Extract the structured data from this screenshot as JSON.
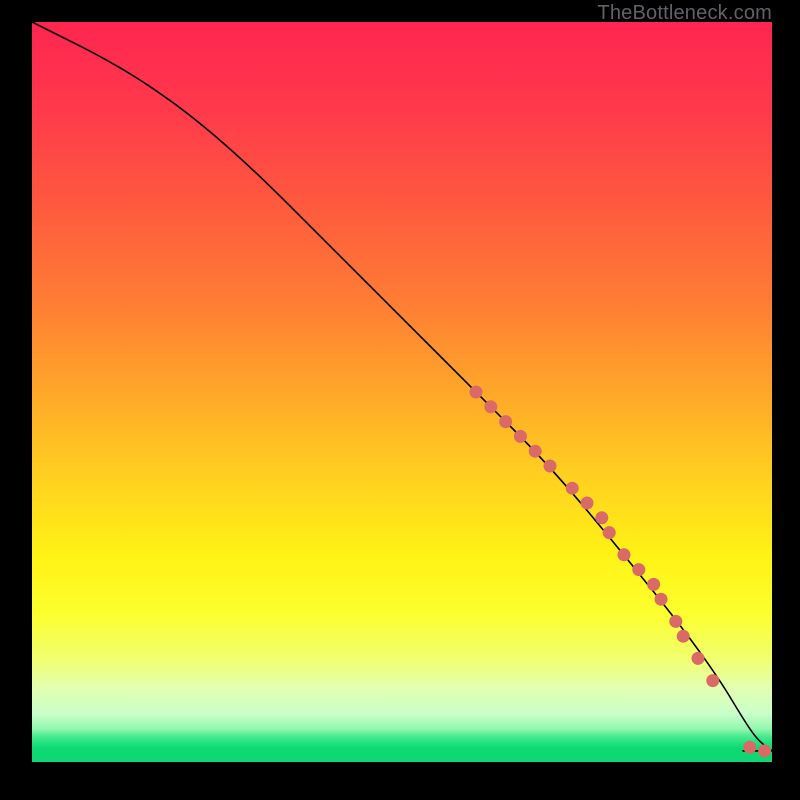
{
  "watermark": "TheBottleneck.com",
  "colors": {
    "dot": "#d96a65",
    "line": "#000000",
    "gradient_stops": [
      {
        "offset": 0.0,
        "color": "#ff2550"
      },
      {
        "offset": 0.12,
        "color": "#ff3a4b"
      },
      {
        "offset": 0.25,
        "color": "#ff5a3e"
      },
      {
        "offset": 0.38,
        "color": "#ff7d34"
      },
      {
        "offset": 0.5,
        "color": "#ffa729"
      },
      {
        "offset": 0.62,
        "color": "#ffd21f"
      },
      {
        "offset": 0.72,
        "color": "#fff215"
      },
      {
        "offset": 0.8,
        "color": "#fcff2e"
      },
      {
        "offset": 0.86,
        "color": "#f0ff6e"
      },
      {
        "offset": 0.9,
        "color": "#e3ffb0"
      },
      {
        "offset": 0.935,
        "color": "#c9ffc9"
      },
      {
        "offset": 0.955,
        "color": "#93f7af"
      },
      {
        "offset": 0.965,
        "color": "#4beb8f"
      },
      {
        "offset": 0.975,
        "color": "#1fe07c"
      },
      {
        "offset": 0.982,
        "color": "#0fd873"
      },
      {
        "offset": 1.0,
        "color": "#0fd873"
      }
    ]
  },
  "chart_data": {
    "type": "line",
    "title": "",
    "xlabel": "",
    "ylabel": "",
    "xlim": [
      0,
      100
    ],
    "ylim": [
      0,
      100
    ],
    "series": [
      {
        "name": "curve",
        "x": [
          0,
          4,
          9,
          15,
          22,
          30,
          40,
          50,
          60,
          70,
          80,
          88,
          93,
          96,
          98,
          100
        ],
        "y": [
          100,
          98,
          95.5,
          92,
          87,
          80,
          70,
          60,
          50,
          40,
          28,
          18,
          11,
          6,
          3,
          1.5
        ]
      },
      {
        "name": "flat-tail",
        "x": [
          96,
          100
        ],
        "y": [
          1.5,
          1.5
        ]
      }
    ],
    "scatter": {
      "name": "points",
      "x": [
        60,
        62,
        64,
        66,
        68,
        70,
        73,
        75,
        77,
        78,
        80,
        82,
        84,
        85,
        87,
        88,
        90,
        92,
        97,
        99
      ],
      "y": [
        50,
        48,
        46,
        44,
        42,
        40,
        37,
        35,
        33,
        31,
        28,
        26,
        24,
        22,
        19,
        17,
        14,
        11,
        2,
        1.5
      ]
    }
  }
}
